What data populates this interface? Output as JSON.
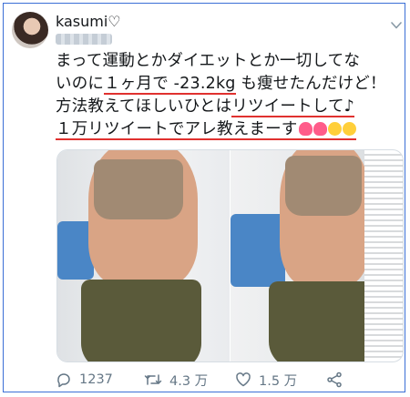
{
  "user": {
    "display_name": "kasumi♡"
  },
  "tweet": {
    "line1": "まって運動とかダイエットとか一切してな",
    "line2_prefix": "いのに",
    "line2_highlight": "１ヶ月で -23.2kg",
    "line2_suffix": " も痩せたんだけど！",
    "line3_prefix": "方法教えてほしいひとは",
    "line3_highlight": "リツイートして♪",
    "line4_highlight": "１万リツイートでアレ教えまーす"
  },
  "actions": {
    "reply_count": "1237",
    "retweet_count": "4.3 万",
    "like_count": "1.5 万"
  },
  "icons": [
    "reply-icon",
    "retweet-icon",
    "like-icon",
    "share-icon",
    "chevron-down-icon",
    "heart-emoji",
    "blushing-face-emoji"
  ],
  "colors": {
    "underline": "#e0312f",
    "action_gray": "#657786",
    "border": "#3b6fd6"
  }
}
